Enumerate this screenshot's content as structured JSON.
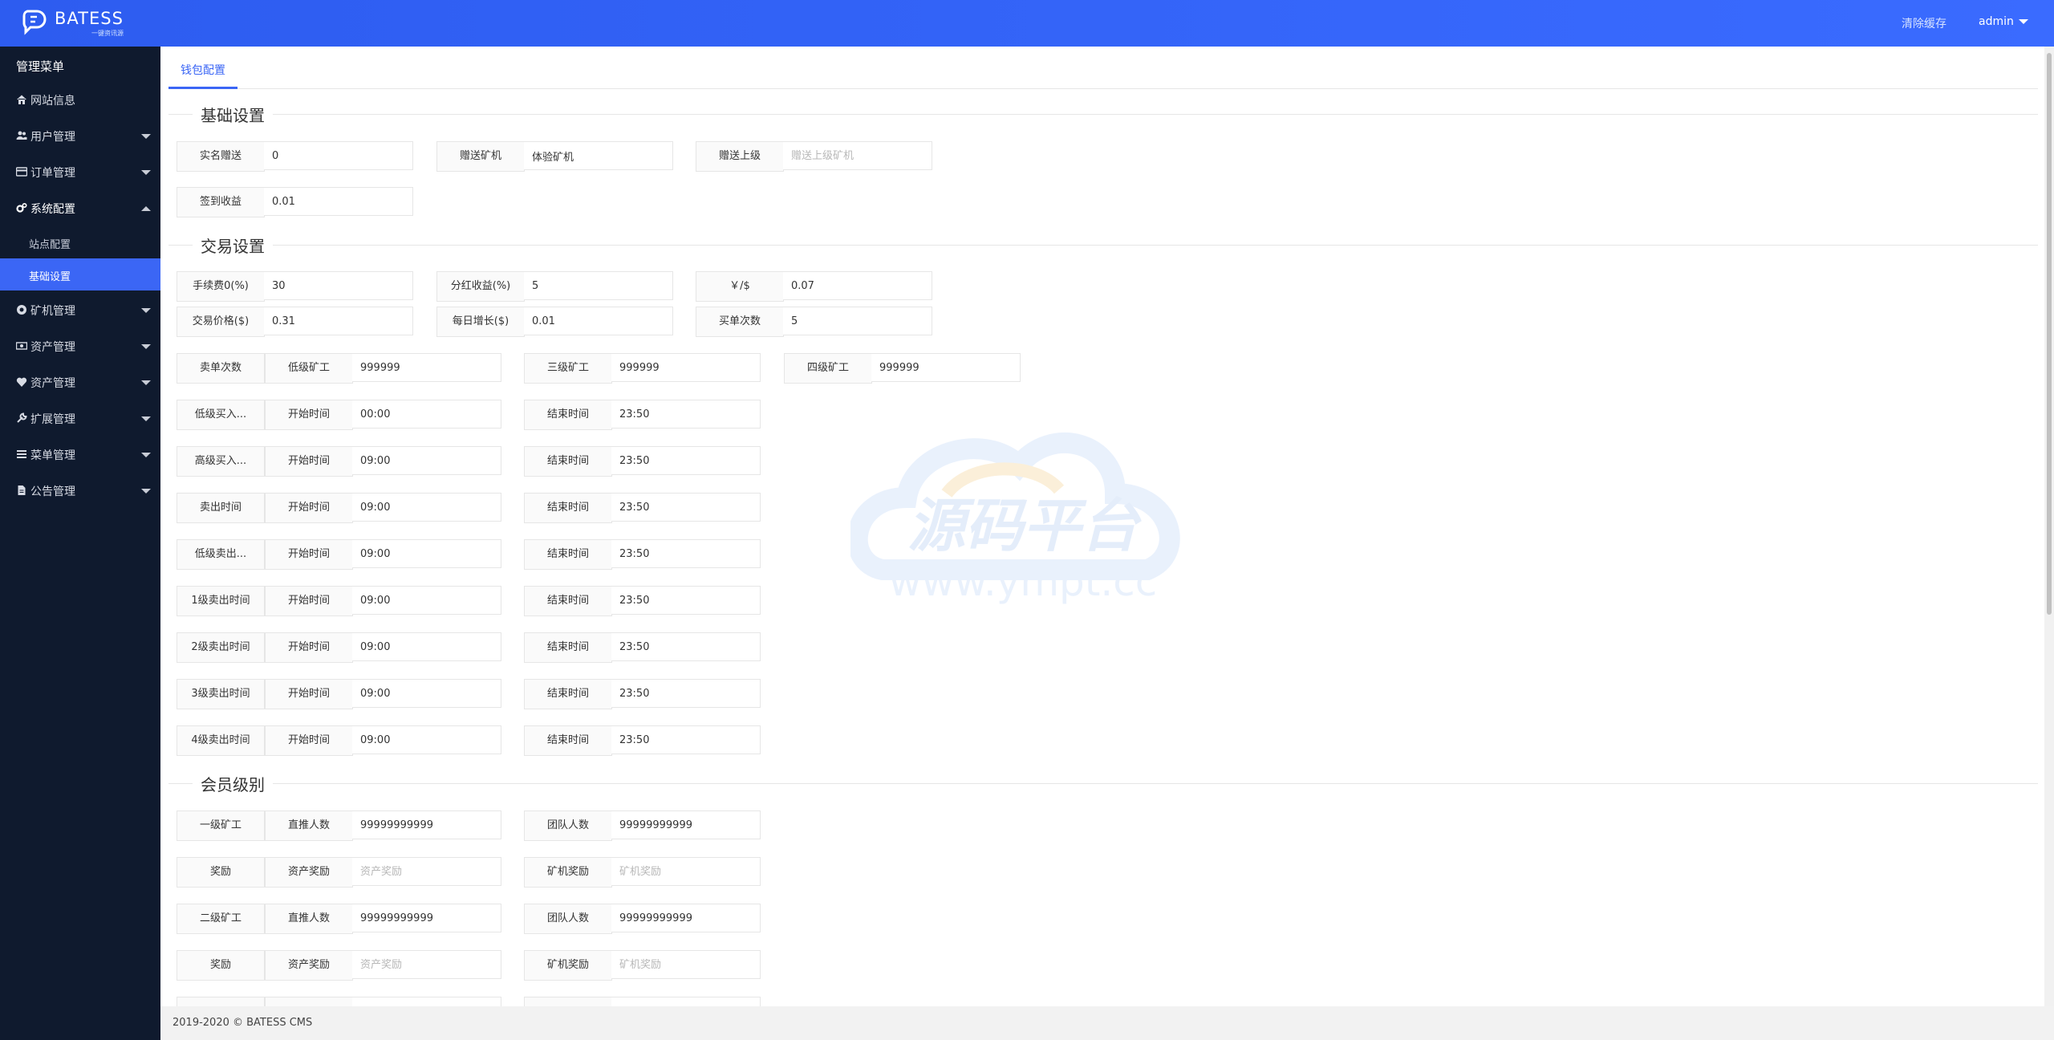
{
  "header": {
    "brand": "BATESS",
    "brand_sub": "一键资讯源",
    "clear_cache": "清除缓存",
    "user": "admin"
  },
  "sidebar": {
    "title": "管理菜单",
    "items": [
      {
        "label": "网站信息",
        "icon": "home-icon"
      },
      {
        "label": "用户管理",
        "icon": "users-icon"
      },
      {
        "label": "订单管理",
        "icon": "credit-card-icon"
      },
      {
        "label": "系统配置",
        "icon": "cogs-icon"
      },
      {
        "label": "矿机管理",
        "icon": "rebel-icon"
      },
      {
        "label": "资产管理",
        "icon": "money-icon"
      },
      {
        "label": "资产管理",
        "icon": "heartbeat-icon"
      },
      {
        "label": "扩展管理",
        "icon": "wrench-icon"
      },
      {
        "label": "菜单管理",
        "icon": "bars-icon"
      },
      {
        "label": "公告管理",
        "icon": "file-icon"
      }
    ],
    "sub_items": [
      "站点配置",
      "基础设置"
    ],
    "active_color": "#3b66f5"
  },
  "main": {
    "tab": "钱包配置",
    "sections": {
      "basic": "基础设置",
      "trade": "交易设置",
      "member": "会员级别"
    },
    "basic": {
      "realname_gift": {
        "label": "实名赠送",
        "value": "0"
      },
      "gift_miner": {
        "label": "赠送矿机",
        "value": "体验矿机"
      },
      "gift_parent": {
        "label": "赠送上级",
        "placeholder": "赠送上级矿机"
      },
      "checkin_income": {
        "label": "签到收益",
        "value": "0.01"
      }
    },
    "trade": {
      "fee": {
        "label": "手续费0(%)",
        "value": "30"
      },
      "dividend": {
        "label": "分红收益(%)",
        "value": "5"
      },
      "rate": {
        "label": "￥/$",
        "value": "0.07"
      },
      "price": {
        "label": "交易价格($)",
        "value": "0.31"
      },
      "daily_growth": {
        "label": "每日增长($)",
        "value": "0.01"
      },
      "buy_times": {
        "label": "买单次数",
        "value": "5"
      },
      "sell_times_row": {
        "label": "卖单次数",
        "f1": {
          "label": "低级矿工",
          "value": "999999"
        },
        "f2": {
          "label": "三级矿工",
          "value": "999999"
        },
        "f3": {
          "label": "四级矿工",
          "value": "999999"
        }
      },
      "time_rows": [
        {
          "label": "低级买入...",
          "start_label": "开始时间",
          "start": "00:00",
          "end_label": "结束时间",
          "end": "23:50"
        },
        {
          "label": "高级买入...",
          "start_label": "开始时间",
          "start": "09:00",
          "end_label": "结束时间",
          "end": "23:50"
        },
        {
          "label": "卖出时间",
          "start_label": "开始时间",
          "start": "09:00",
          "end_label": "结束时间",
          "end": "23:50"
        },
        {
          "label": "低级卖出...",
          "start_label": "开始时间",
          "start": "09:00",
          "end_label": "结束时间",
          "end": "23:50"
        },
        {
          "label": "1级卖出时间",
          "start_label": "开始时间",
          "start": "09:00",
          "end_label": "结束时间",
          "end": "23:50"
        },
        {
          "label": "2级卖出时间",
          "start_label": "开始时间",
          "start": "09:00",
          "end_label": "结束时间",
          "end": "23:50"
        },
        {
          "label": "3级卖出时间",
          "start_label": "开始时间",
          "start": "09:00",
          "end_label": "结束时间",
          "end": "23:50"
        },
        {
          "label": "4级卖出时间",
          "start_label": "开始时间",
          "start": "09:00",
          "end_label": "结束时间",
          "end": "23:50"
        }
      ]
    },
    "member": {
      "rows": [
        {
          "label": "一级矿工",
          "a_label": "直推人数",
          "a_value": "99999999999",
          "a_placeholder": "",
          "b_label": "团队人数",
          "b_value": "99999999999",
          "b_placeholder": ""
        },
        {
          "label": "奖励",
          "a_label": "资产奖励",
          "a_value": "",
          "a_placeholder": "资产奖励",
          "b_label": "矿机奖励",
          "b_value": "",
          "b_placeholder": "矿机奖励"
        },
        {
          "label": "二级矿工",
          "a_label": "直推人数",
          "a_value": "99999999999",
          "a_placeholder": "",
          "b_label": "团队人数",
          "b_value": "99999999999",
          "b_placeholder": ""
        },
        {
          "label": "奖励",
          "a_label": "资产奖励",
          "a_value": "",
          "a_placeholder": "资产奖励",
          "b_label": "矿机奖励",
          "b_value": "",
          "b_placeholder": "矿机奖励"
        }
      ]
    }
  },
  "watermark": {
    "title": "源码平台",
    "url": "www.ympt.cc"
  },
  "footer": "2019-2020 © BATESS CMS"
}
